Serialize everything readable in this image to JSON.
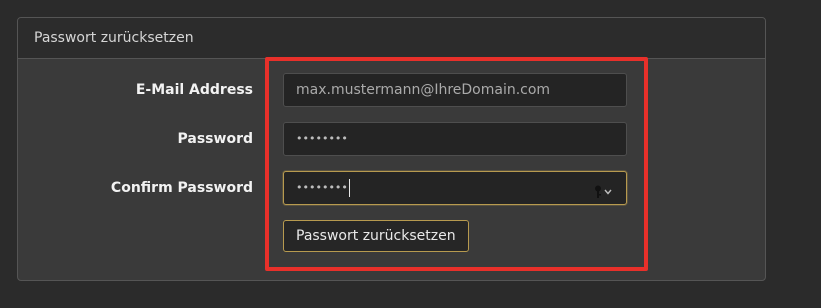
{
  "card": {
    "title": "Passwort zurücksetzen"
  },
  "form": {
    "email_label": "E-Mail Address",
    "email_value": "max.mustermann@IhreDomain.com",
    "password_label": "Password",
    "password_value": "••••••••",
    "confirm_label": "Confirm Password",
    "confirm_value": "••••••••",
    "submit_label": "Passwort zurücksetzen"
  },
  "colors": {
    "accent": "#b79a4f",
    "highlight": "#e8302a"
  },
  "icons": {
    "confirm_field": "keychain-autofill-icon"
  }
}
